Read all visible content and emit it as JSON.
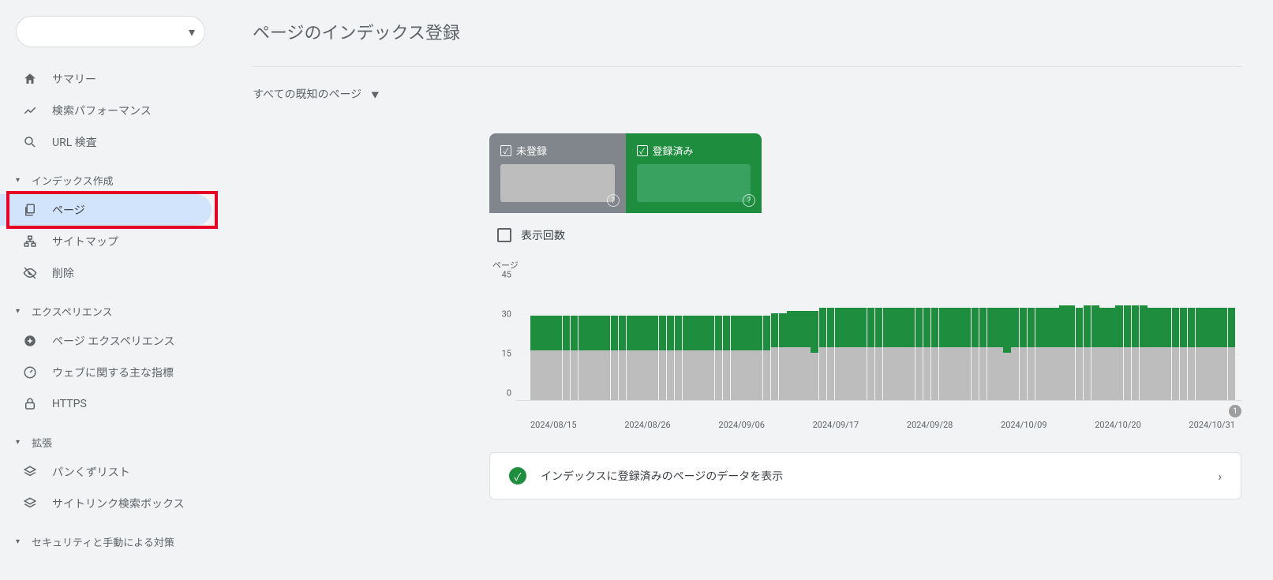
{
  "sidebar": {
    "property_selector_placeholder": "",
    "items": {
      "summary": "サマリー",
      "performance": "検索パフォーマンス",
      "url_inspect": "URL 検査"
    },
    "section_indexing": "インデックス作成",
    "indexing": {
      "pages": "ページ",
      "sitemaps": "サイトマップ",
      "removals": "削除"
    },
    "section_experience": "エクスペリエンス",
    "experience": {
      "page_exp": "ページ エクスペリエンス",
      "cwv": "ウェブに関する主な指標",
      "https": "HTTPS"
    },
    "section_enhance": "拡張",
    "enhance": {
      "breadcrumbs": "パンくずリスト",
      "sitelinks": "サイトリンク検索ボックス"
    },
    "section_security": "セキュリティと手動による対策"
  },
  "main": {
    "title": "ページのインデックス登録",
    "filter_label": "すべての既知のページ",
    "tab_unregistered": "未登録",
    "tab_registered": "登録済み",
    "impressions_label": "表示回数",
    "chart_axis_label": "ページ",
    "footer_text": "インデックスに登録済みのページのデータを表示",
    "marker_label": "1"
  },
  "chart_data": {
    "type": "bar",
    "ylabel": "ページ",
    "ylim": [
      0,
      45
    ],
    "yticks": [
      0,
      15,
      30,
      45
    ],
    "x_labels": [
      "2024/08/15",
      "2024/08/26",
      "2024/09/06",
      "2024/09/17",
      "2024/09/28",
      "2024/10/09",
      "2024/10/20",
      "2024/10/31"
    ],
    "series": [
      {
        "name": "未登録",
        "color": "#bdbdbd"
      },
      {
        "name": "登録済み",
        "color": "#1e8e3e"
      }
    ],
    "stacked_values": [
      {
        "unreg": 19,
        "reg": 13
      },
      {
        "unreg": 19,
        "reg": 13
      },
      {
        "unreg": 19,
        "reg": 13
      },
      {
        "unreg": 19,
        "reg": 13
      },
      {
        "unreg": 19,
        "reg": 13
      },
      {
        "unreg": 19,
        "reg": 13
      },
      {
        "unreg": 19,
        "reg": 13
      },
      {
        "unreg": 19,
        "reg": 13
      },
      {
        "unreg": 19,
        "reg": 13
      },
      {
        "unreg": 19,
        "reg": 13
      },
      {
        "unreg": 19,
        "reg": 13
      },
      {
        "unreg": 19,
        "reg": 13
      },
      {
        "unreg": 19,
        "reg": 13
      },
      {
        "unreg": 19,
        "reg": 13
      },
      {
        "unreg": 19,
        "reg": 13
      },
      {
        "unreg": 19,
        "reg": 13
      },
      {
        "unreg": 19,
        "reg": 13
      },
      {
        "unreg": 19,
        "reg": 13
      },
      {
        "unreg": 19,
        "reg": 13
      },
      {
        "unreg": 19,
        "reg": 13
      },
      {
        "unreg": 19,
        "reg": 13
      },
      {
        "unreg": 19,
        "reg": 13
      },
      {
        "unreg": 19,
        "reg": 13
      },
      {
        "unreg": 19,
        "reg": 13
      },
      {
        "unreg": 19,
        "reg": 13
      },
      {
        "unreg": 19,
        "reg": 13
      },
      {
        "unreg": 19,
        "reg": 13
      },
      {
        "unreg": 19,
        "reg": 13
      },
      {
        "unreg": 19,
        "reg": 13
      },
      {
        "unreg": 19,
        "reg": 13
      },
      {
        "unreg": 20,
        "reg": 13
      },
      {
        "unreg": 20,
        "reg": 13
      },
      {
        "unreg": 20,
        "reg": 14
      },
      {
        "unreg": 20,
        "reg": 14
      },
      {
        "unreg": 20,
        "reg": 14
      },
      {
        "unreg": 18,
        "reg": 16
      },
      {
        "unreg": 20,
        "reg": 15
      },
      {
        "unreg": 20,
        "reg": 15
      },
      {
        "unreg": 20,
        "reg": 15
      },
      {
        "unreg": 20,
        "reg": 15
      },
      {
        "unreg": 20,
        "reg": 15
      },
      {
        "unreg": 20,
        "reg": 15
      },
      {
        "unreg": 20,
        "reg": 15
      },
      {
        "unreg": 20,
        "reg": 15
      },
      {
        "unreg": 20,
        "reg": 15
      },
      {
        "unreg": 20,
        "reg": 15
      },
      {
        "unreg": 20,
        "reg": 15
      },
      {
        "unreg": 20,
        "reg": 15
      },
      {
        "unreg": 20,
        "reg": 15
      },
      {
        "unreg": 20,
        "reg": 15
      },
      {
        "unreg": 20,
        "reg": 15
      },
      {
        "unreg": 20,
        "reg": 15
      },
      {
        "unreg": 20,
        "reg": 15
      },
      {
        "unreg": 20,
        "reg": 15
      },
      {
        "unreg": 20,
        "reg": 15
      },
      {
        "unreg": 20,
        "reg": 15
      },
      {
        "unreg": 20,
        "reg": 15
      },
      {
        "unreg": 20,
        "reg": 15
      },
      {
        "unreg": 20,
        "reg": 15
      },
      {
        "unreg": 18,
        "reg": 17
      },
      {
        "unreg": 20,
        "reg": 15
      },
      {
        "unreg": 20,
        "reg": 15
      },
      {
        "unreg": 20,
        "reg": 15
      },
      {
        "unreg": 20,
        "reg": 15
      },
      {
        "unreg": 20,
        "reg": 15
      },
      {
        "unreg": 20,
        "reg": 15
      },
      {
        "unreg": 20,
        "reg": 16
      },
      {
        "unreg": 20,
        "reg": 16
      },
      {
        "unreg": 20,
        "reg": 15
      },
      {
        "unreg": 20,
        "reg": 16
      },
      {
        "unreg": 20,
        "reg": 16
      },
      {
        "unreg": 20,
        "reg": 15
      },
      {
        "unreg": 20,
        "reg": 15
      },
      {
        "unreg": 20,
        "reg": 16
      },
      {
        "unreg": 20,
        "reg": 16
      },
      {
        "unreg": 20,
        "reg": 16
      },
      {
        "unreg": 20,
        "reg": 16
      },
      {
        "unreg": 20,
        "reg": 15
      },
      {
        "unreg": 20,
        "reg": 15
      },
      {
        "unreg": 20,
        "reg": 15
      },
      {
        "unreg": 20,
        "reg": 15
      },
      {
        "unreg": 20,
        "reg": 15
      },
      {
        "unreg": 20,
        "reg": 15
      },
      {
        "unreg": 20,
        "reg": 15
      },
      {
        "unreg": 20,
        "reg": 15
      },
      {
        "unreg": 20,
        "reg": 15
      },
      {
        "unreg": 20,
        "reg": 15
      },
      {
        "unreg": 20,
        "reg": 15
      }
    ]
  }
}
